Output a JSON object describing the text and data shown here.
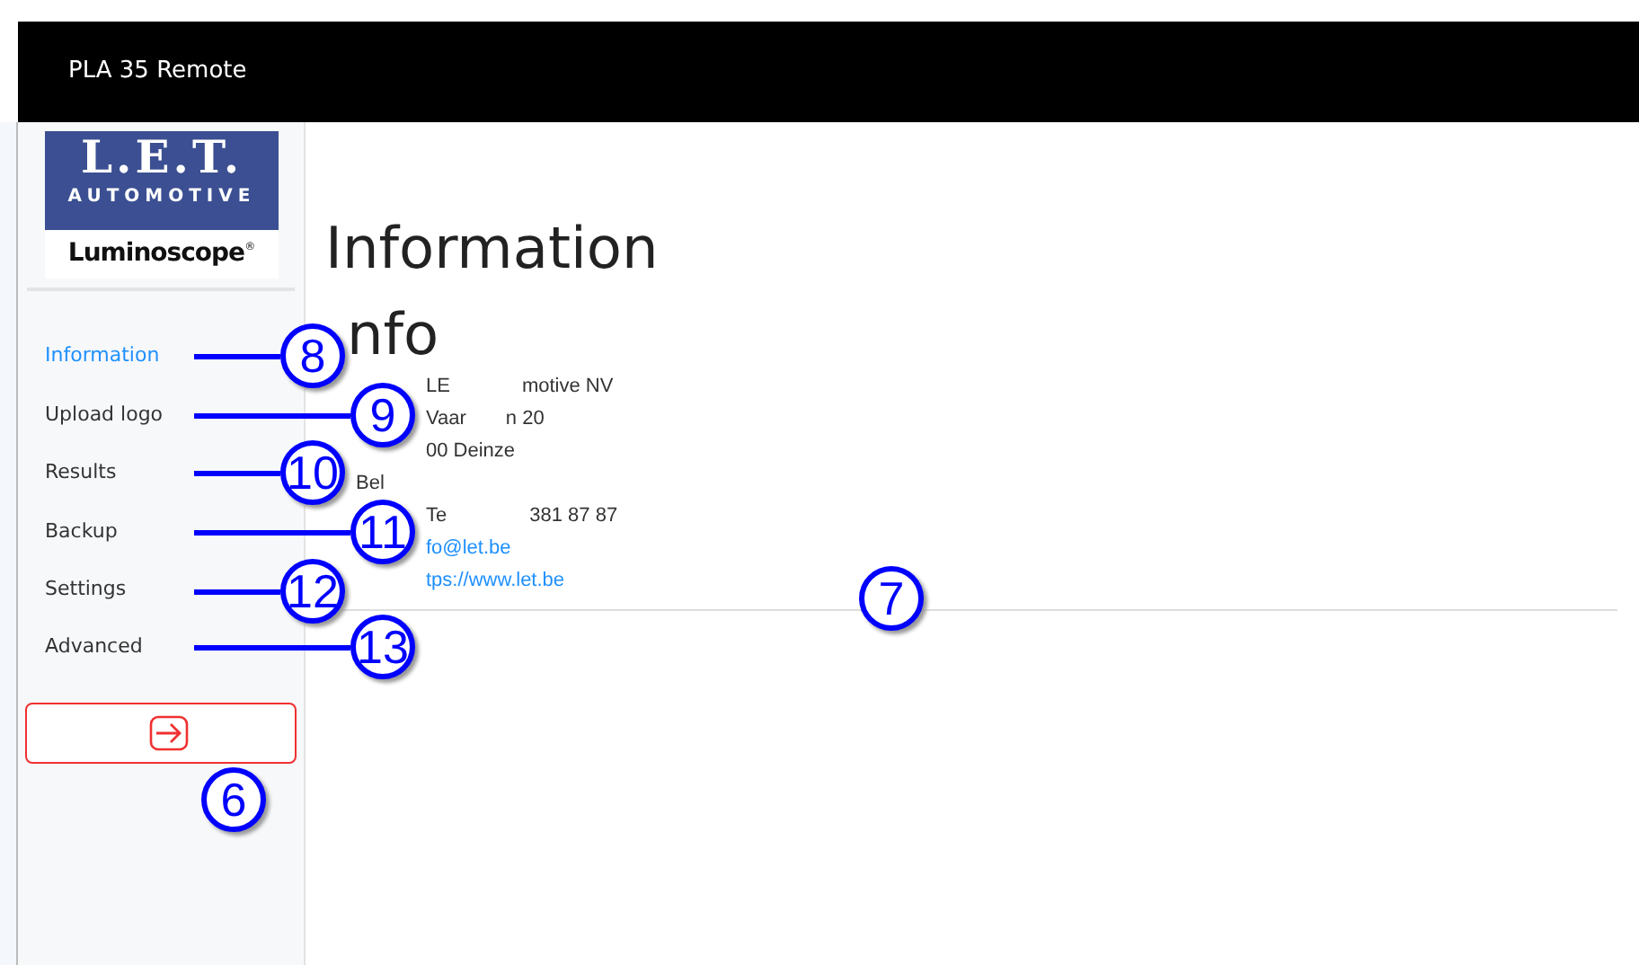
{
  "window": {
    "title": "PLA 35 Remote"
  },
  "logo": {
    "brand": "L.E.T.",
    "tagline": "AUTOMOTIVE",
    "product": "Luminoscope",
    "mark": "®"
  },
  "nav": [
    {
      "label": "Information",
      "selected": true,
      "callout": "8"
    },
    {
      "label": "Upload logo",
      "selected": false,
      "callout": "9"
    },
    {
      "label": "Results",
      "selected": false,
      "callout": "10"
    },
    {
      "label": "Backup",
      "selected": false,
      "callout": "11"
    },
    {
      "label": "Settings",
      "selected": false,
      "callout": "12"
    },
    {
      "label": "Advanced",
      "selected": false,
      "callout": "13"
    }
  ],
  "logout": {
    "callout": "6"
  },
  "page": {
    "title": "Information",
    "subtitle": "nfo",
    "callout": "7",
    "address": [
      {
        "kind": "text",
        "parts": [
          "LE",
          "motive NV"
        ]
      },
      {
        "kind": "text",
        "parts": [
          "Vaar",
          "n 20"
        ]
      },
      {
        "kind": "text",
        "parts": [
          "00 Deinze"
        ]
      },
      {
        "kind": "text",
        "parts": [
          "Bel"
        ]
      },
      {
        "kind": "text",
        "parts": [
          "Te",
          "381 87 87"
        ]
      },
      {
        "kind": "link",
        "parts": [
          "fo@let.be"
        ]
      },
      {
        "kind": "link",
        "parts": [
          "tps://www.let.be"
        ]
      }
    ]
  }
}
